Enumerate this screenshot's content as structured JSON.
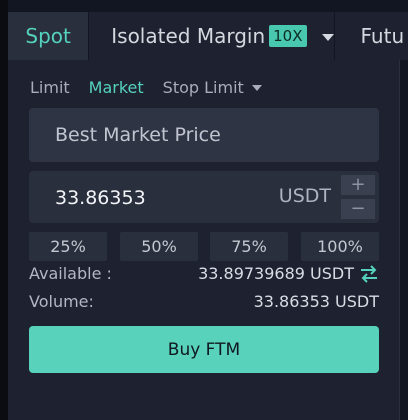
{
  "tabs": {
    "spot": "Spot",
    "margin": "Isolated Margin",
    "leverage": "10X",
    "futures": "Futu"
  },
  "order_types": {
    "limit": "Limit",
    "market": "Market",
    "stop_limit": "Stop Limit",
    "active": "Market"
  },
  "form": {
    "price_label": "Best Market Price",
    "amount_value": "33.86353",
    "amount_unit": "USDT",
    "step_plus": "+",
    "step_minus": "−",
    "percentages": [
      "25%",
      "50%",
      "75%",
      "100%"
    ]
  },
  "summary": {
    "available_label": "Available :",
    "available_value": "33.89739689 USDT",
    "volume_label": "Volume:",
    "volume_value": "33.86353 USDT"
  },
  "action": {
    "button_label": "Buy FTM"
  },
  "colors": {
    "accent": "#55d2bd",
    "buy_button": "#58d2bb",
    "leverage_badge": "#47c8af",
    "panel_background": "#1e2230"
  },
  "icons": {
    "margin_dropdown": "chevron-down-icon",
    "stop_limit_dropdown": "chevron-down-icon",
    "transfer": "transfer-arrows-icon"
  }
}
